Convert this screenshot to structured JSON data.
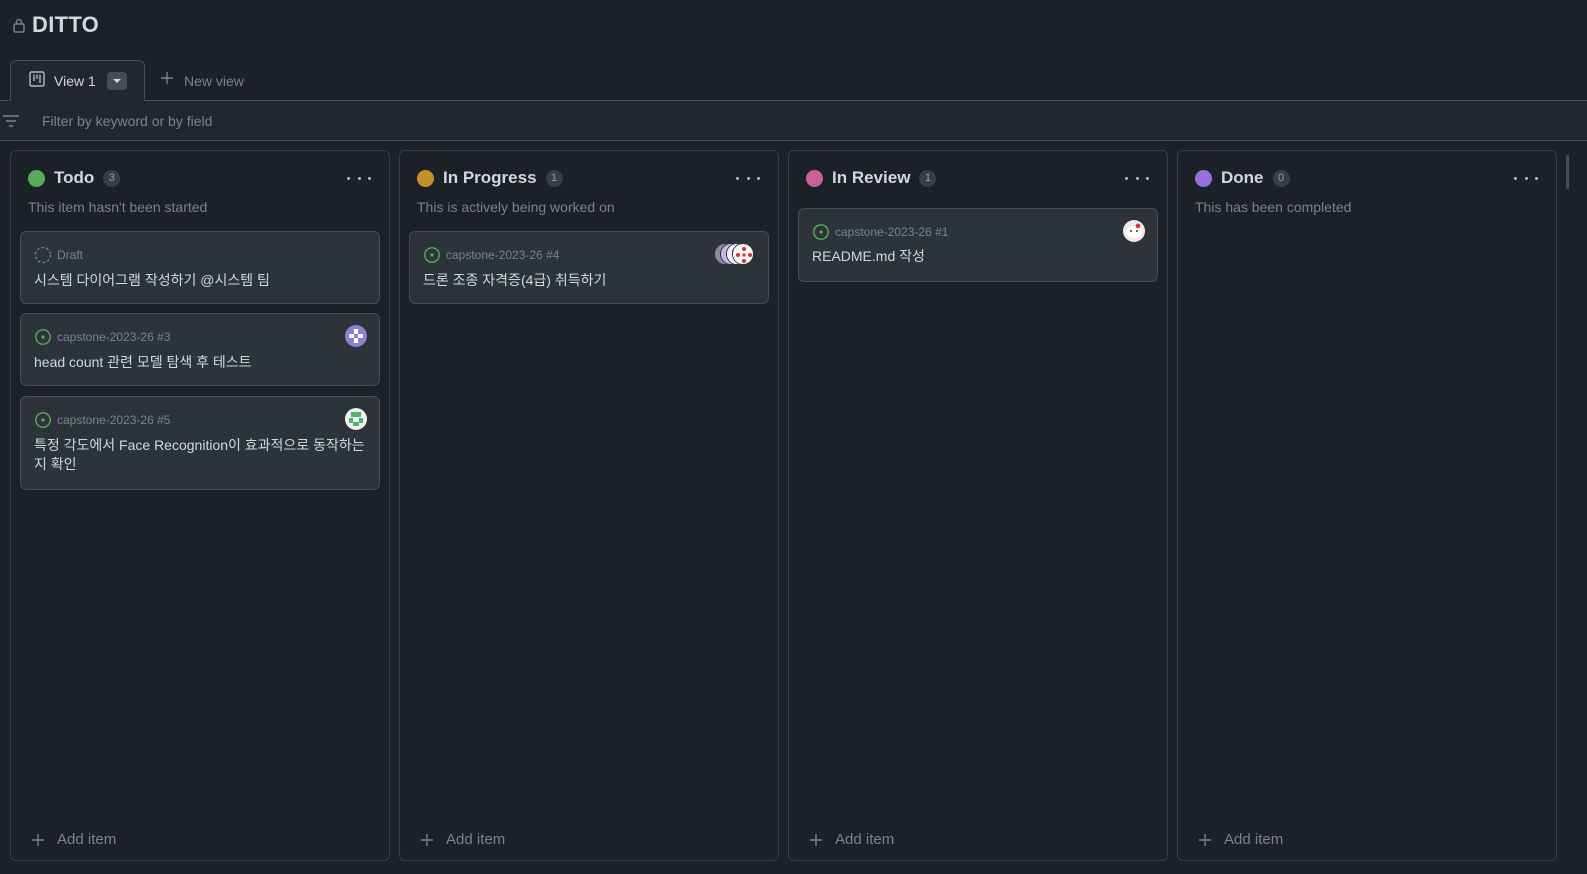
{
  "project": {
    "title": "DITTO"
  },
  "tabs": {
    "active_label": "View 1",
    "new_view_label": "New view"
  },
  "filter": {
    "placeholder": "Filter by keyword or by field"
  },
  "colors": {
    "todo": "#57ab5a",
    "in_progress": "#c69026",
    "in_review": "#c96198",
    "done": "#986ee2",
    "open_issue": "#57ab5a"
  },
  "columns": [
    {
      "title": "Todo",
      "count": "3",
      "description": "This item hasn't been started",
      "add_label": "Add item",
      "cards": [
        {
          "meta": "Draft",
          "title": "시스템 다이어그램 작성하기 @시스템 팀",
          "icon": "draft-icon"
        },
        {
          "meta": "capstone-2023-26 #3",
          "title": "head count 관련 모델 탐색 후 테스트",
          "icon": "issue-opened-icon"
        },
        {
          "meta": "capstone-2023-26 #5",
          "title": "특정 각도에서 Face Recognition이 효과적으로 동작하는지 확인",
          "icon": "issue-opened-icon"
        }
      ]
    },
    {
      "title": "In Progress",
      "count": "1",
      "description": "This is actively being worked on",
      "add_label": "Add item",
      "cards": [
        {
          "meta": "capstone-2023-26 #4",
          "title": "드론 조종 자격증(4급) 취득하기",
          "icon": "issue-opened-icon"
        }
      ]
    },
    {
      "title": "In Review",
      "count": "1",
      "description": "",
      "add_label": "Add item",
      "cards": [
        {
          "meta": "capstone-2023-26 #1",
          "title": "README.md 작성",
          "icon": "issue-opened-icon"
        }
      ]
    },
    {
      "title": "Done",
      "count": "0",
      "description": "This has been completed",
      "add_label": "Add item",
      "cards": []
    }
  ]
}
